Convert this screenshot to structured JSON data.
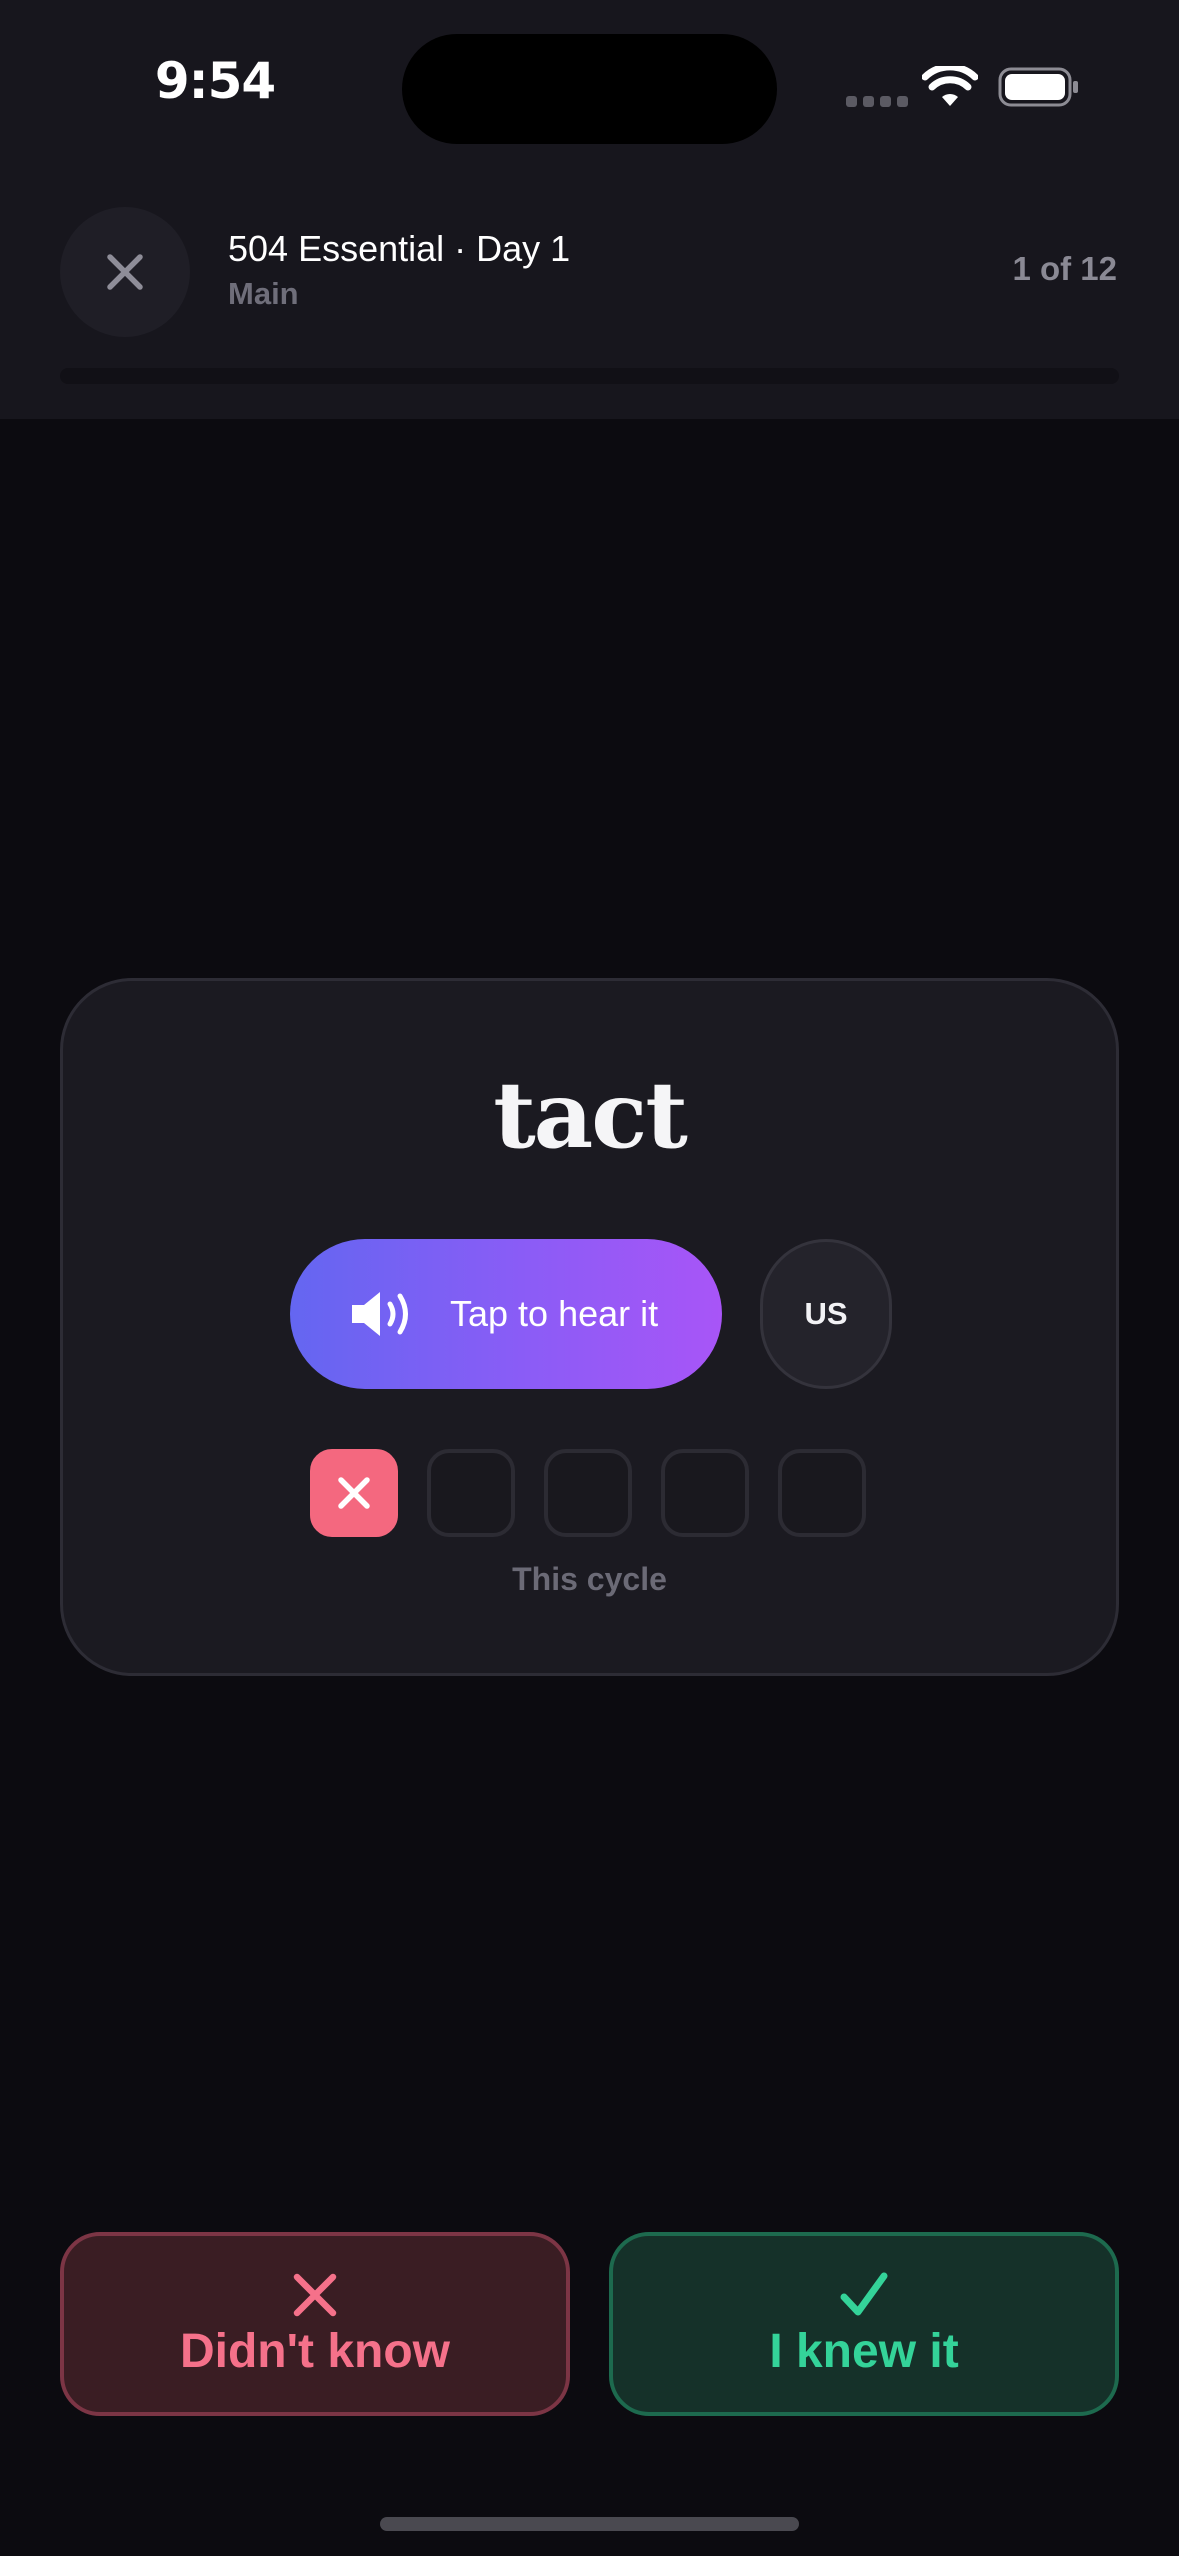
{
  "status_bar": {
    "time": "9:54",
    "icons": [
      "cellular-signal-icon",
      "wifi-icon",
      "battery-icon"
    ]
  },
  "header": {
    "close_icon": "close-icon",
    "title": "504 Essential · Day 1",
    "subtitle": "Main",
    "progress_text": "1 of 12",
    "progress_fraction": 0.0
  },
  "card": {
    "word": "tact",
    "pronounce_button": {
      "icon": "speaker-icon",
      "label": "Tap to hear it"
    },
    "accent_button": "US",
    "cycle": {
      "label": "This cycle",
      "slots": [
        "miss",
        "empty",
        "empty",
        "empty",
        "empty"
      ]
    }
  },
  "actions": {
    "didnt_know": {
      "icon": "x-icon",
      "label": "Didn't know"
    },
    "knew_it": {
      "icon": "checkmark-icon",
      "label": "I knew it"
    }
  },
  "colors": {
    "background": "#0c0b10",
    "card": "#1b1a21",
    "accent_gradient_start": "#6466f1",
    "accent_gradient_end": "#a855f7",
    "miss": "#f4687f",
    "success": "#34d399"
  }
}
